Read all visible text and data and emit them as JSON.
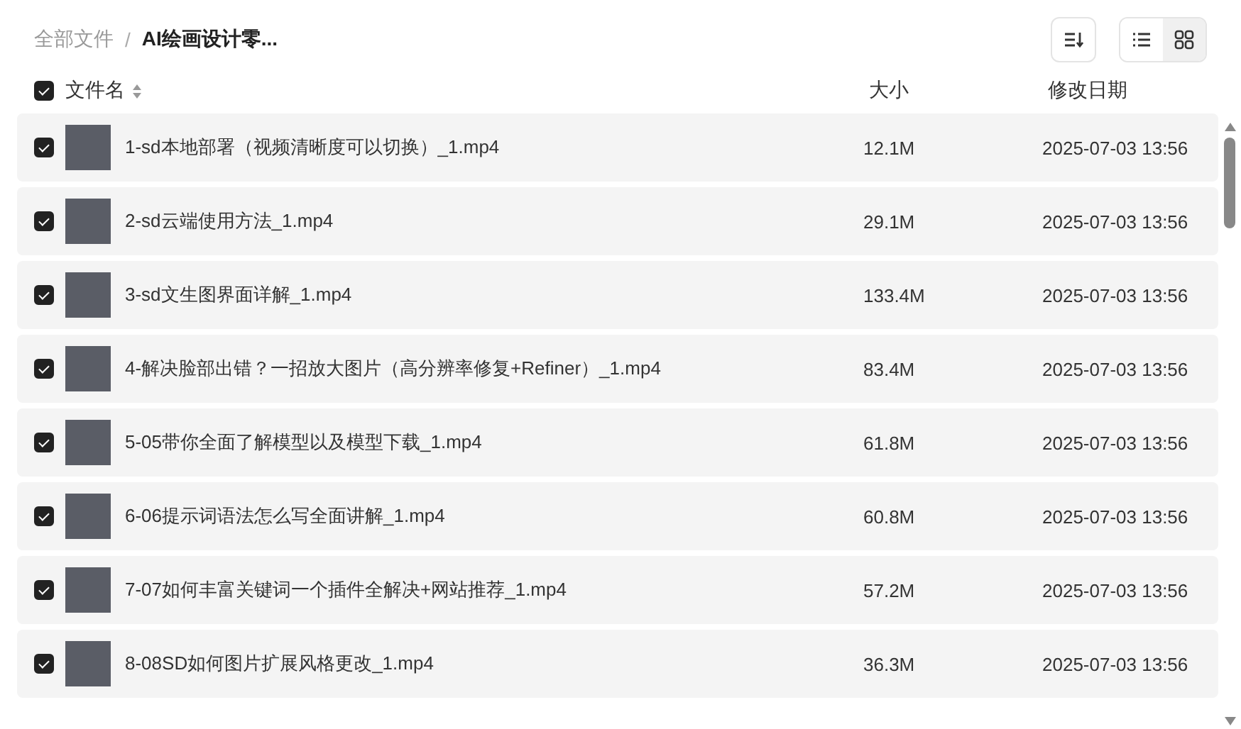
{
  "breadcrumb": [
    {
      "label": "全部文件",
      "current": false
    },
    {
      "label": "AI绘画设计零...",
      "current": true
    }
  ],
  "breadcrumb_separator": "/",
  "view_buttons": [
    {
      "kind": "list",
      "selected": false
    },
    {
      "kind": "grid",
      "selected": true
    }
  ],
  "table": {
    "header": {
      "checked": true,
      "columns": [
        "文件名",
        "大小",
        "修改日期"
      ]
    },
    "rows": [
      {
        "checked": true,
        "name": "1-sd本地部署（视频清晰度可以切换）_1.mp4",
        "size": "12.1M",
        "date": "2025-07-03 13:56"
      },
      {
        "checked": true,
        "name": "2-sd云端使用方法_1.mp4",
        "size": "29.1M",
        "date": "2025-07-03 13:56"
      },
      {
        "checked": true,
        "name": "3-sd文生图界面详解_1.mp4",
        "size": "133.4M",
        "date": "2025-07-03 13:56"
      },
      {
        "checked": true,
        "name": "4-解决脸部出错？一招放大图片（高分辨率修复+Refiner）_1.mp4",
        "size": "83.4M",
        "date": "2025-07-03 13:56"
      },
      {
        "checked": true,
        "name": "5-05带你全面了解模型以及模型下载_1.mp4",
        "size": "61.8M",
        "date": "2025-07-03 13:56"
      },
      {
        "checked": true,
        "name": "6-06提示词语法怎么写全面讲解_1.mp4",
        "size": "60.8M",
        "date": "2025-07-03 13:56"
      },
      {
        "checked": true,
        "name": "7-07如何丰富关键词一个插件全解决+网站推荐_1.mp4",
        "size": "57.2M",
        "date": "2025-07-03 13:56"
      },
      {
        "checked": true,
        "name": "8-08SD如何图片扩展风格更改_1.mp4",
        "size": "36.3M",
        "date": "2025-07-03 13:56"
      }
    ]
  }
}
